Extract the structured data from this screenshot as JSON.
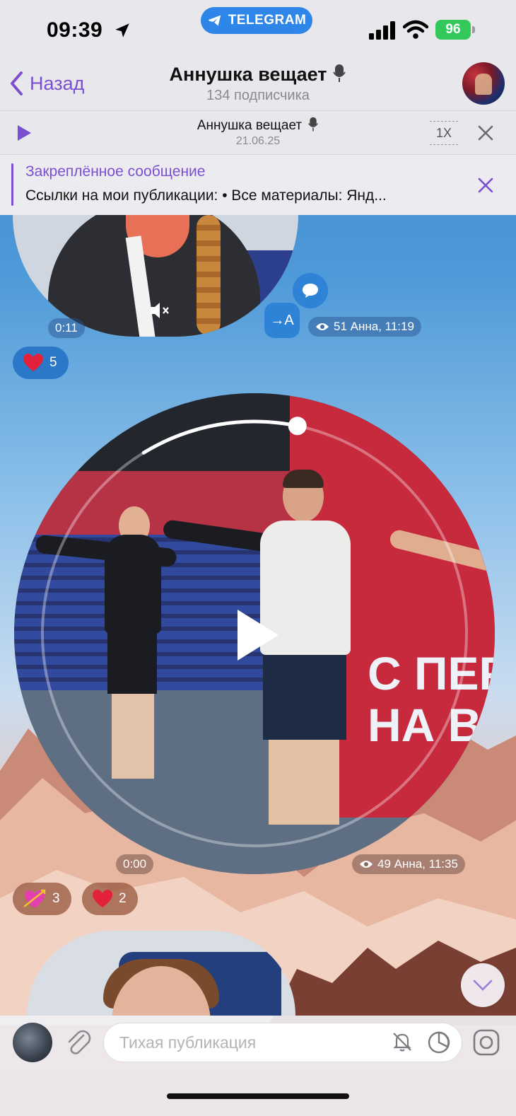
{
  "status_bar": {
    "time": "09:39",
    "app_pill": "TELEGRAM",
    "battery": "96"
  },
  "header": {
    "back_label": "Назад",
    "title": "Аннушка вещает",
    "subtitle": "134 подписчика"
  },
  "player": {
    "title": "Аннушка вещает",
    "date": "21.06.25",
    "speed": "1X"
  },
  "pinned": {
    "label": "Закреплённое сообщение",
    "text": "Ссылки на мои публикации: • Все материалы: Янд..."
  },
  "messages": [
    {
      "duration": "0:11",
      "meta": "51 Анна, 11:19",
      "translate_label": "→A",
      "reactions": [
        {
          "icon": "red-heart",
          "count": "5"
        }
      ]
    },
    {
      "duration": "0:00",
      "meta": "49 Анна, 11:35",
      "banner_text": "С ПЕРЕ\nНА ВЭ",
      "progress": 0.12,
      "reactions": [
        {
          "icon": "heart-with-arrow",
          "count": "3"
        },
        {
          "icon": "red-heart",
          "count": "2"
        }
      ]
    }
  ],
  "input": {
    "placeholder": "Тихая публикация"
  },
  "colors": {
    "accent": "#7b4fd0",
    "telegram_blue": "#2e86e8",
    "battery_green": "#34c759"
  }
}
